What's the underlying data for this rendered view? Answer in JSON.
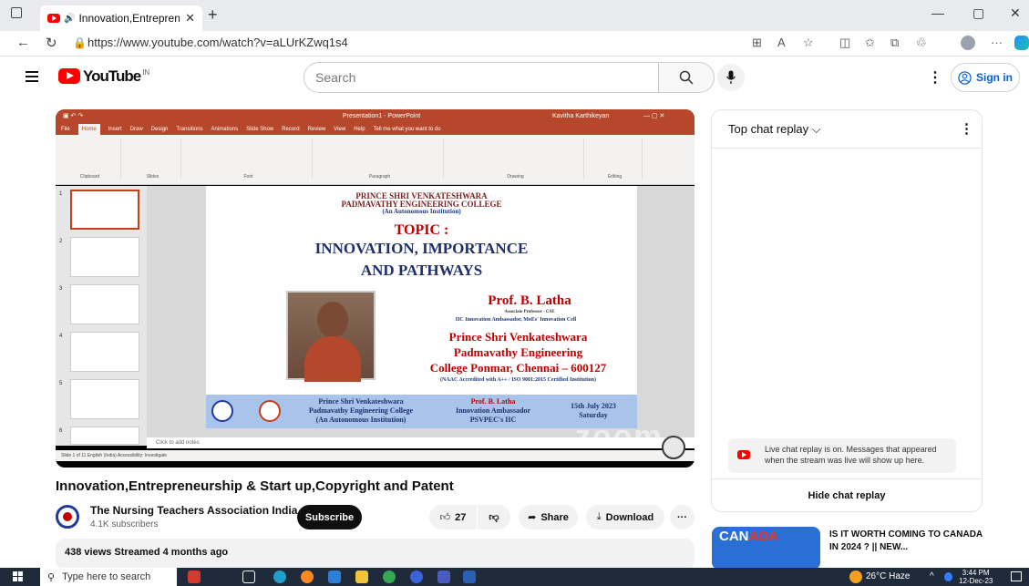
{
  "browser": {
    "tab_title": "Innovation,Entrepreneurship",
    "url": "https://www.youtube.com/watch?v=aLUrKZwq1s4",
    "win_min": "—",
    "win_max": "▢",
    "win_close": "✕",
    "new_tab": "+"
  },
  "header": {
    "logo_text": "YouTube",
    "country_code": "IN",
    "search_placeholder": "Search",
    "signin_label": "Sign in"
  },
  "video_frame": {
    "ppt_title": "Presentation1 - PowerPoint",
    "ppt_user": "Kavitha Karthikeyan",
    "ppt_menu": [
      "File",
      "Home",
      "Insert",
      "Draw",
      "Design",
      "Transitions",
      "Animations",
      "Slide Show",
      "Record",
      "Review",
      "View",
      "Help",
      "Tell me what you want to do"
    ],
    "ribbon_groups": [
      "Clipboard",
      "Slides",
      "Font",
      "Paragraph",
      "Drawing",
      "Editing"
    ],
    "slide": {
      "college_line1": "PRINCE SHRI VENKATESHWARA",
      "college_line2": "PADMAVATHY ENGINEERING COLLEGE",
      "college_line3": "(An Autonomous Institution)",
      "topic": "TOPIC :",
      "title_line1": "INNOVATION, IMPORTANCE",
      "title_line2": "AND PATHWAYS",
      "speaker": "Prof. B. Latha",
      "speaker_role": "Associate Professor - CSE",
      "speaker_amb": "IIC Innovation Ambassador, MoEs' Innovation Cell",
      "college_a": "Prince Shri Venkateshwara",
      "college_b": "Padmavathy Engineering",
      "college_c": "College Ponmar, Chennai – 600127",
      "naac": "(NAAC Accredited with A++ / ISO 9001:2015 Certified Institution)",
      "banner_col1": [
        "Prince Shri Venkateshwara",
        "Padmavathy Engineering College",
        "(An Autonomous Institution)"
      ],
      "banner_col2": [
        "Prof. B. Latha",
        "Innovation Ambassador",
        "PSVPEC's IIC"
      ],
      "banner_col3": [
        "15th July 2023",
        "Saturday"
      ]
    },
    "notes_placeholder": "Click to add notes",
    "status_text": "Slide 1 of 11    English (India)    Accessibility: Investigate",
    "watermark": "zoom",
    "thumb_numbers": [
      "1",
      "2",
      "3",
      "4",
      "5",
      "6"
    ]
  },
  "video": {
    "title": "Innovation,Entrepreneurship & Start up,Copyright and Patent",
    "channel_name": "The Nursing Teachers Association India",
    "subscribers": "4.1K subscribers",
    "subscribe_label": "Subscribe",
    "likes": "27",
    "share_label": "Share",
    "download_label": "Download",
    "meta": "438 views  Streamed 4 months ago"
  },
  "chat": {
    "header": "Top chat replay",
    "message": "Live chat replay is on. Messages that appeared when the stream was live will show up here.",
    "hide_label": "Hide chat replay"
  },
  "recommendation": {
    "thumb_text_a": "CAN",
    "thumb_text_b": "ADA",
    "title": "IS IT WORTH COMING TO CANADA IN 2024 ? || NEW..."
  },
  "taskbar": {
    "search_placeholder": "Type here to search",
    "weather": "26°C Haze",
    "time": "3:44 PM",
    "date": "12-Dec-23"
  },
  "colors": {
    "youtube_red": "#ff0000",
    "ppt_orange": "#b7472a",
    "link_blue": "#065fd4"
  }
}
